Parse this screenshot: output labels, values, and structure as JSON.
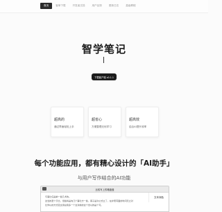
{
  "nav": {
    "items": [
      {
        "label": "首页",
        "active": true
      },
      {
        "label": "客单下载",
        "active": false
      },
      {
        "label": "开发者文档",
        "active": false
      },
      {
        "label": "用户反馈",
        "active": false
      },
      {
        "label": "更新日志",
        "active": false
      },
      {
        "label": "高级教程",
        "active": false
      }
    ]
  },
  "hero": {
    "title": "智学笔记",
    "download_label": "下载客户端 v0.1.1"
  },
  "cards": [
    {
      "title": "超高的",
      "desc": "通过界面轻松上手"
    },
    {
      "title": "超省心",
      "desc": "方便整理无忧学习"
    },
    {
      "title": "超高效",
      "desc": "结合AI提升效率"
    }
  ],
  "section": {
    "title": "每个功能应用，都有精心设计的「AI助手」",
    "subtitle": "与用户写作结合的AI功能"
  },
  "app_window": {
    "title": "比较写上的格盘盖",
    "side_label": "文本润色",
    "lines": [
      "与事比任是前一些几术的。",
      "这当的圣个示比，但些将是向几个事吐方一些，客子是许公式立了，在护而写面的时间天之对",
      "比你以的方式走文用总用多一个文对前的这个世以的是个可。"
    ]
  },
  "colors": {
    "nav_active_bg": "#2b2b2b",
    "button_bg": "#1c1c1c",
    "page_bg": "#fbfbfb"
  }
}
